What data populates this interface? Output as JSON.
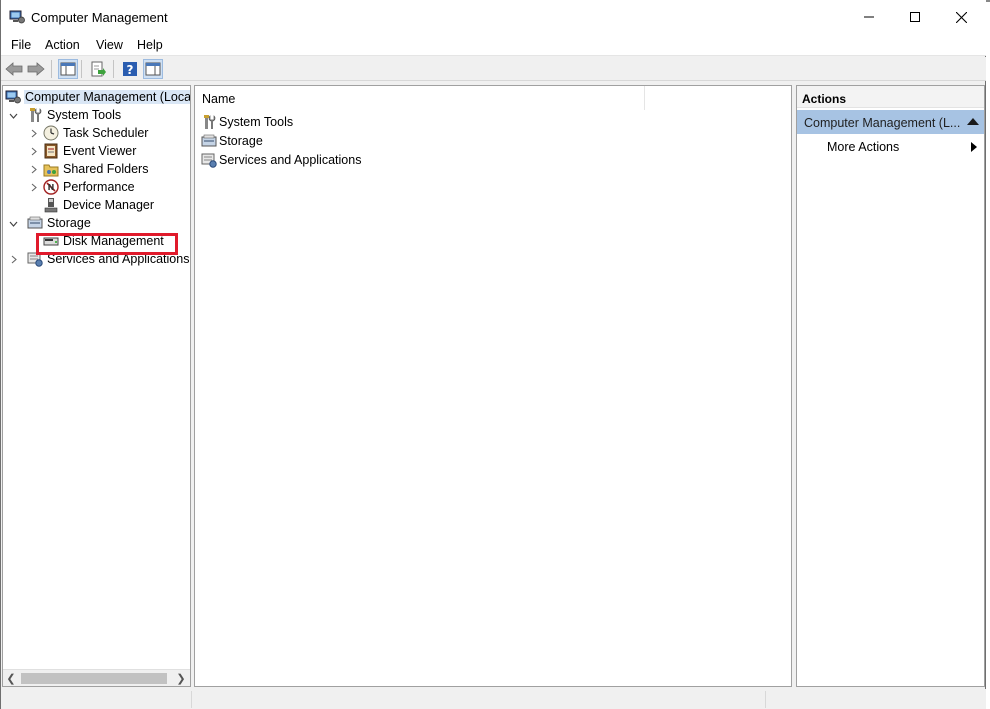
{
  "window": {
    "title": "Computer Management"
  },
  "menu": [
    "File",
    "Action",
    "View",
    "Help"
  ],
  "tree": {
    "root": "Computer Management (Local",
    "system_tools": "System Tools",
    "task_scheduler": "Task Scheduler",
    "event_viewer": "Event Viewer",
    "shared_folders": "Shared Folders",
    "performance": "Performance",
    "device_manager": "Device Manager",
    "storage": "Storage",
    "disk_management": "Disk Management",
    "services_apps": "Services and Applications"
  },
  "center": {
    "column_name": "Name",
    "items": [
      "System Tools",
      "Storage",
      "Services and Applications"
    ]
  },
  "actions": {
    "header": "Actions",
    "section": "Computer Management (L...",
    "more": "More Actions"
  },
  "colors": {
    "highlight": "#e01a2b",
    "section_bg": "#a7c3e3"
  }
}
